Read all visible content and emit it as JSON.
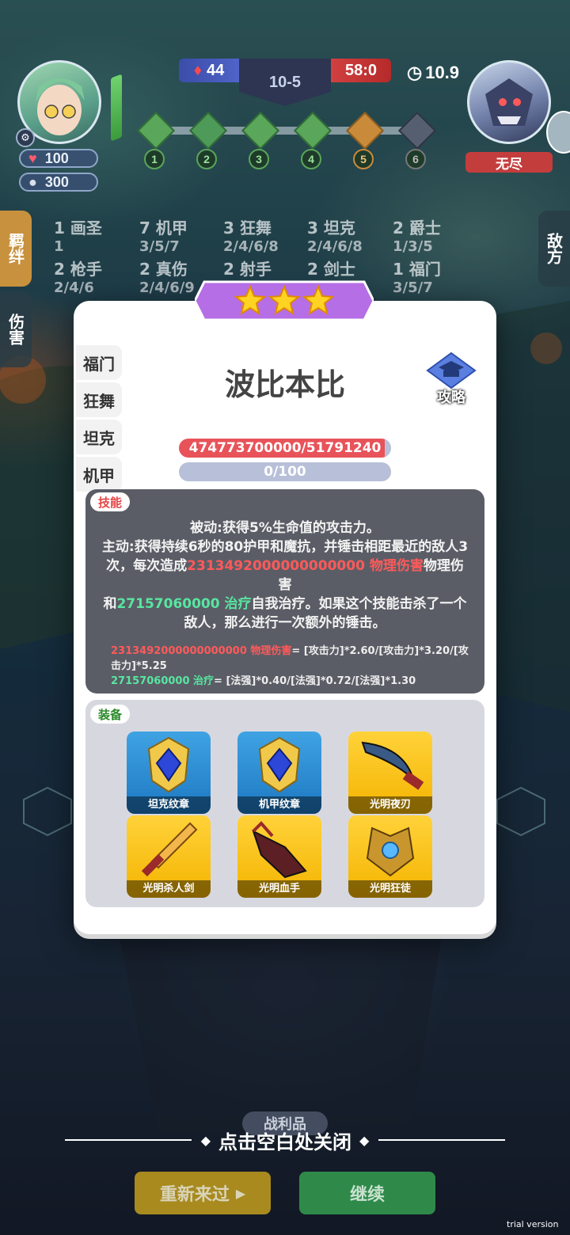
{
  "hud": {
    "player_hp": "100",
    "player_gold": "300",
    "score_left": "44",
    "stage": "10-5",
    "score_right": "58:0",
    "timer": "10.9",
    "enemy_name": "无尽",
    "rounds": [
      "1",
      "2",
      "3",
      "4",
      "5",
      "6"
    ]
  },
  "side_tabs": {
    "left_1": "羁绊",
    "left_2": "伤害",
    "right_1": "敌方"
  },
  "traits": [
    {
      "count": "1",
      "name": "画圣",
      "tiers": "1"
    },
    {
      "count": "7",
      "name": "机甲",
      "tiers": "3/5/7"
    },
    {
      "count": "3",
      "name": "狂舞",
      "tiers": "2/4/6/8"
    },
    {
      "count": "3",
      "name": "坦克",
      "tiers": "2/4/6/8"
    },
    {
      "count": "2",
      "name": "爵士",
      "tiers": "1/3/5"
    },
    {
      "count": "2",
      "name": "枪手",
      "tiers": "2/4/6"
    },
    {
      "count": "2",
      "name": "真伤",
      "tiers": "2/4/6/9"
    },
    {
      "count": "2",
      "name": "射手",
      "tiers": ""
    },
    {
      "count": "2",
      "name": "剑士",
      "tiers": ""
    },
    {
      "count": "1",
      "name": "福门",
      "tiers": "3/5/7"
    }
  ],
  "modal": {
    "stars": 3,
    "trait_tabs": [
      "福门",
      "狂舞",
      "坦克",
      "机甲"
    ],
    "hero_name": "波比本比",
    "guide_label": "攻略",
    "hp_bar": "474773700000/51791240",
    "mana_bar": "0/100",
    "skill_tag": "技能",
    "skill_passive": "被动:获得5%生命值的攻击力。",
    "skill_active_1": "主动:获得持续6秒的80护甲和魔抗，并锤击相距最近的敌人3次，每次造成",
    "skill_damage_value": "2313492000000000000 物理伤害",
    "skill_active_2": "物理伤害",
    "skill_and": "和",
    "skill_heal_value": "27157060000 治疗",
    "skill_active_3": "自我治疗。如果这个技能击杀了一个敌人，那么进行一次额外的锤击。",
    "formula_damage_value": "2313492000000000000 物理伤害",
    "formula_damage_expr": "= [攻击力]*2.60/[攻击力]*3.20/[攻击力]*5.25",
    "formula_heal_value": "27157060000 治疗",
    "formula_heal_expr": "= [法强]*0.40/[法强]*0.72/[法强]*1.30",
    "equip_tag": "装备",
    "equipment": [
      {
        "name": "坦克纹章",
        "color": "blue",
        "icon": "emblem-icon"
      },
      {
        "name": "机甲纹章",
        "color": "blue",
        "icon": "emblem-icon"
      },
      {
        "name": "光明夜刃",
        "color": "gold",
        "icon": "dagger-icon"
      },
      {
        "name": "光明杀人剑",
        "color": "gold",
        "icon": "sword-icon"
      },
      {
        "name": "光明血手",
        "color": "gold",
        "icon": "gauntlet-icon"
      },
      {
        "name": "光明狂徒",
        "color": "gold",
        "icon": "armor-icon"
      }
    ]
  },
  "bottom": {
    "close_hint": "点击空白处关闭",
    "loot_label": "战利品",
    "retry_label": "重新来过",
    "continue_label": "继续",
    "watermark": "trial version"
  }
}
